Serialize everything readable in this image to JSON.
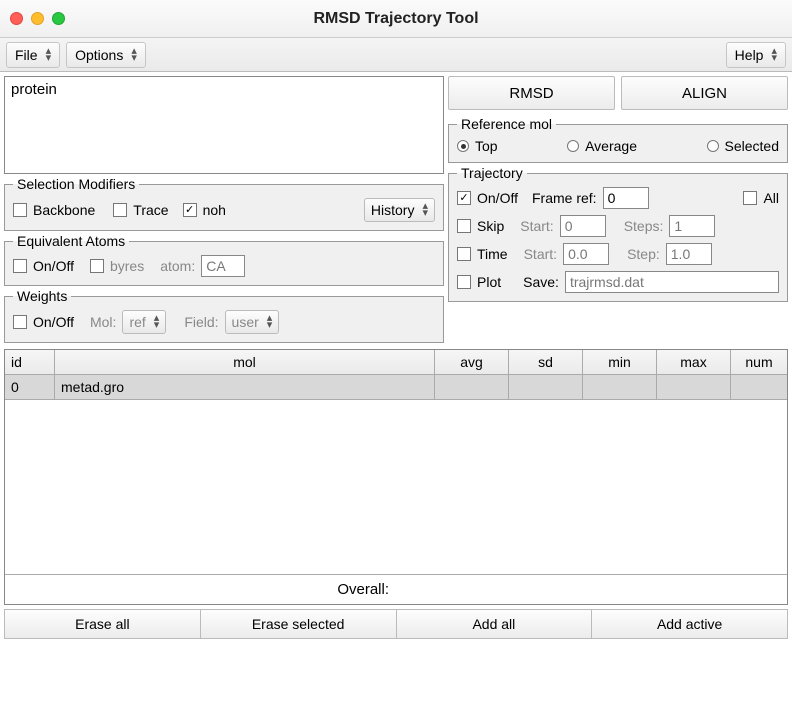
{
  "window": {
    "title": "RMSD Trajectory Tool"
  },
  "menubar": {
    "file": "File",
    "options": "Options",
    "help": "Help"
  },
  "left": {
    "selection_text": "protein",
    "sel_mod": {
      "legend": "Selection Modifiers",
      "backbone": "Backbone",
      "trace": "Trace",
      "noh": "noh",
      "history": "History"
    },
    "equiv": {
      "legend": "Equivalent Atoms",
      "onoff": "On/Off",
      "byres": "byres",
      "atom_label": "atom:",
      "atom_value": "CA"
    },
    "weights": {
      "legend": "Weights",
      "onoff": "On/Off",
      "mol_label": "Mol:",
      "mol_value": "ref",
      "field_label": "Field:",
      "field_value": "user"
    }
  },
  "right": {
    "rmsd_btn": "RMSD",
    "align_btn": "ALIGN",
    "refmol": {
      "legend": "Reference mol",
      "top": "Top",
      "average": "Average",
      "selected": "Selected"
    },
    "traj": {
      "legend": "Trajectory",
      "onoff": "On/Off",
      "frame_ref_label": "Frame ref:",
      "frame_ref_value": "0",
      "all": "All",
      "skip": "Skip",
      "start_label": "Start:",
      "start_value": "0",
      "steps_label": "Steps:",
      "steps_value": "1",
      "time": "Time",
      "time_start_value": "0.0",
      "step_label": "Step:",
      "step_value": "1.0",
      "plot": "Plot",
      "save_label": "Save:",
      "save_value": "trajrmsd.dat"
    }
  },
  "table": {
    "headers": {
      "id": "id",
      "mol": "mol",
      "avg": "avg",
      "sd": "sd",
      "min": "min",
      "max": "max",
      "num": "num"
    },
    "rows": [
      {
        "id": "0",
        "mol": "metad.gro",
        "avg": "",
        "sd": "",
        "min": "",
        "max": "",
        "num": ""
      }
    ],
    "overall": "Overall:"
  },
  "bottom": {
    "erase_all": "Erase all",
    "erase_selected": "Erase selected",
    "add_all": "Add all",
    "add_active": "Add active"
  }
}
